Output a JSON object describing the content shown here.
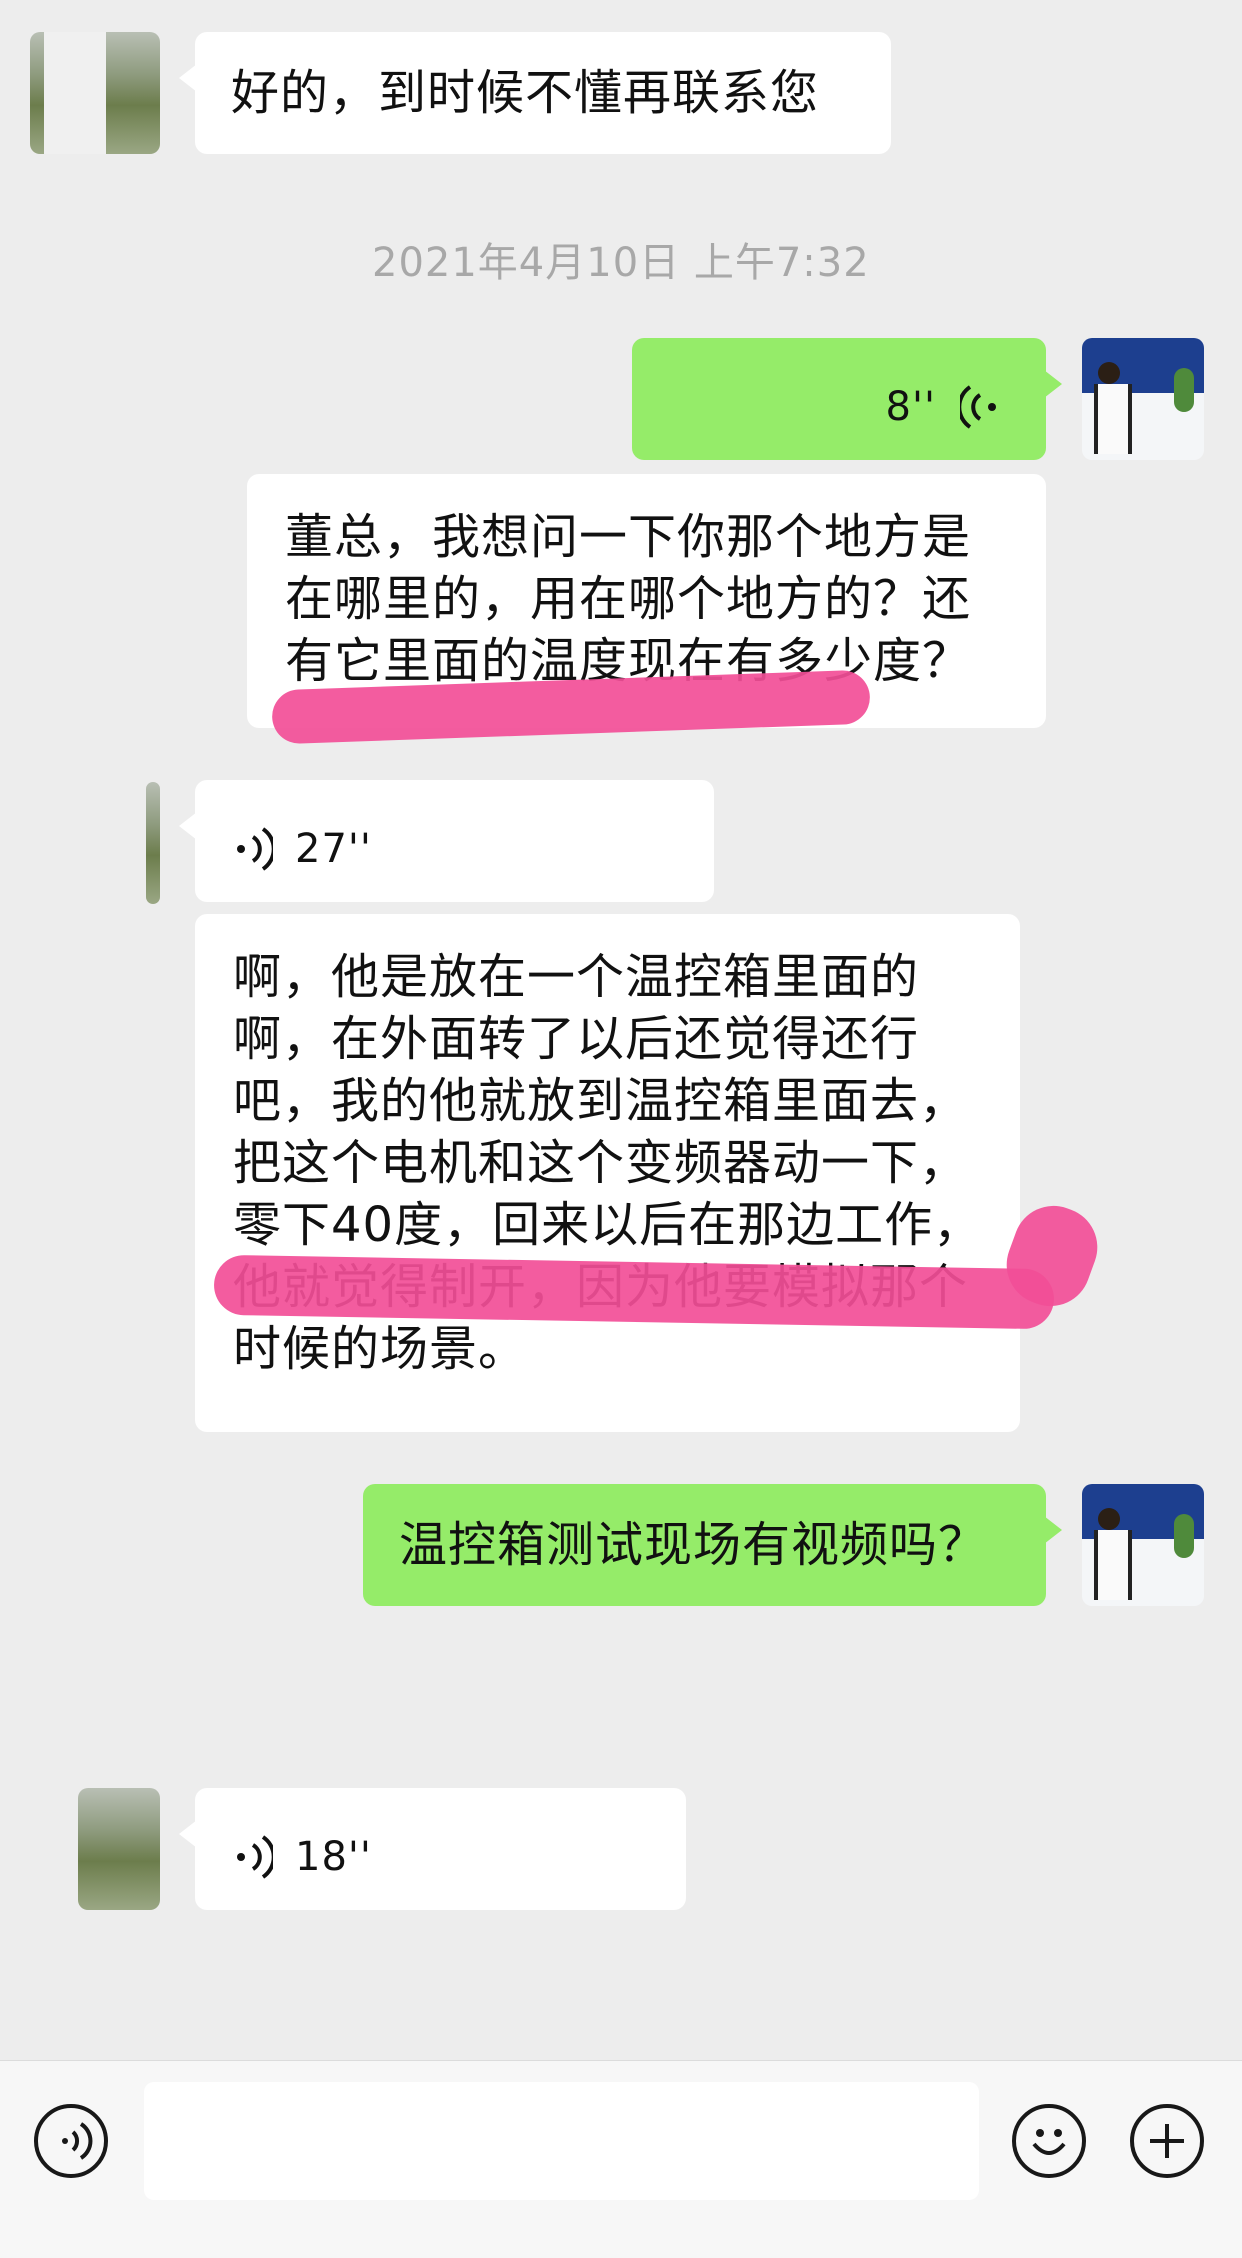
{
  "chat": {
    "msg1": "好的，到时候不懂再联系您",
    "timestamp1": "2021年4月10日 上午7:32",
    "voice_out_duration": "8''",
    "msg2": "董总，我想问一下你那个地方是在哪里的，用在哪个地方的？还有它里面的温度现在有多少度？",
    "voice_in1_duration": "27''",
    "msg3": "啊，他是放在一个温控箱里面的啊，在外面转了以后还觉得还行吧，我的他就放到温控箱里面去，把这个电机和这个变频器动一下，零下40度，回来以后在那边工作，他就觉得制开，因为他要模拟那个时候的场景。",
    "msg4": "温控箱测试现场有视频吗？",
    "voice_in2_duration": "18''"
  },
  "colors": {
    "background": "#ededed",
    "outgoing_bubble": "#95ec69",
    "incoming_bubble": "#ffffff",
    "highlight": "#f24e97"
  },
  "icons": {
    "voice_wave": "voice-wave-icon",
    "voice_mode": "voice-mode-icon",
    "emoji": "emoji-icon",
    "plus": "plus-icon"
  }
}
